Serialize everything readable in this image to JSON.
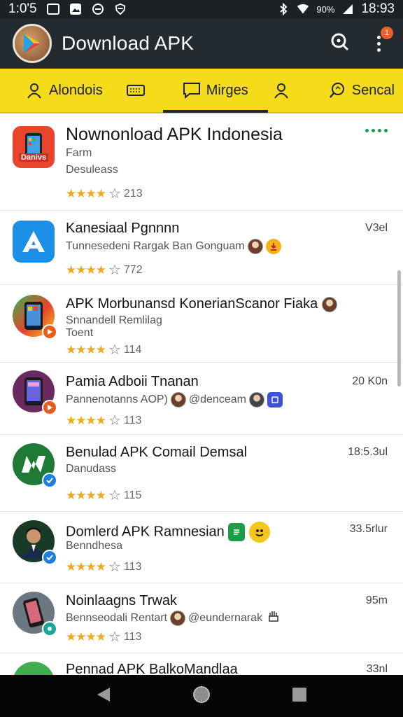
{
  "status_bar": {
    "time_left": "1:0'5",
    "battery": "90%",
    "time_right": "18:93"
  },
  "app_bar": {
    "title": "Download APK",
    "notification_count": "1",
    "colors": {
      "background": "#232a30",
      "text": "#ffffff"
    }
  },
  "tabs": [
    {
      "label": "Alondois",
      "icon": "person-icon"
    },
    {
      "label": "",
      "icon": "ticket-icon"
    },
    {
      "label": "Mirges",
      "icon": "chat-icon",
      "active": true
    },
    {
      "label": "",
      "icon": "person-icon"
    },
    {
      "label": "Sencal",
      "icon": "search-icon"
    }
  ],
  "tab_bar_color": "#f5dc1a",
  "items": [
    {
      "title": "Nownonload APK Indonesia",
      "sub1": "Farm",
      "sub2": "Desuleass",
      "rating_count": "213",
      "right": "",
      "icon_label": "Danivs"
    },
    {
      "title": "Kanesiaal Pgnnnn",
      "sub1": "Tunnesedeni Rargak Ban Gonguam",
      "rating_count": "772",
      "right": "V3el"
    },
    {
      "title": "APK Morbunansd KonerianScanor Fiaka",
      "sub1": "Snnandell Remlilag",
      "sub2": "Toent",
      "rating_count": "114",
      "right": ""
    },
    {
      "title": "Pamia Adboii Tnanan",
      "sub1": "Pannenotanns AOP)",
      "sub1b": "@denceam",
      "rating_count": "113",
      "right": "20 K0n"
    },
    {
      "title": "Benulad APK Comail Demsal",
      "sub1": "Danudass",
      "rating_count": "115",
      "right": "18:5.3ul"
    },
    {
      "title": "Domlerd APK Ramnesian",
      "sub1": "Benndhesa",
      "rating_count": "113",
      "right": "33.5rlur"
    },
    {
      "title": "Noinlaagns Trwak",
      "sub1": "Bennseodali Rentart",
      "sub1b": "@eundernarak",
      "rating_count": "113",
      "right": "95m"
    },
    {
      "title": "Pennad APK BalkoMandlaa",
      "right": "33nl"
    }
  ]
}
